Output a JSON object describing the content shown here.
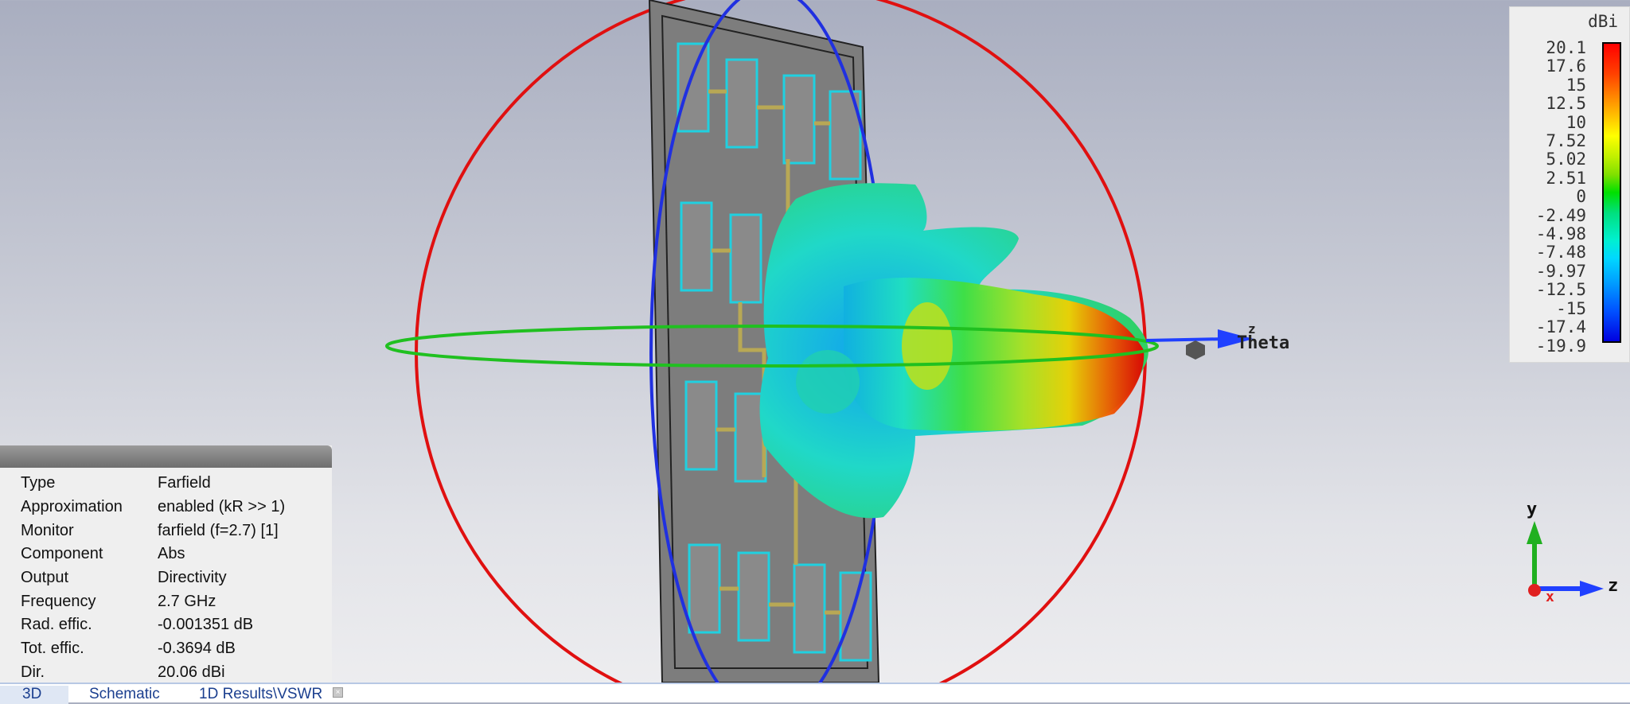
{
  "legend": {
    "unit": "dBi",
    "ticks": [
      "20.1",
      "17.6",
      "15",
      "12.5",
      "10",
      "7.52",
      "5.02",
      "2.51",
      "0",
      "-2.49",
      "-4.98",
      "-7.48",
      "-9.97",
      "-12.5",
      "-15",
      "-17.4",
      "-19.9"
    ]
  },
  "info": {
    "rows": [
      {
        "key": "Type",
        "value": "Farfield"
      },
      {
        "key": "Approximation",
        "value": "enabled (kR >> 1)"
      },
      {
        "key": "Monitor",
        "value": "farfield (f=2.7) [1]"
      },
      {
        "key": "Component",
        "value": "Abs"
      },
      {
        "key": "Output",
        "value": "Directivity"
      },
      {
        "key": "Frequency",
        "value": "2.7 GHz"
      },
      {
        "key": "Rad. effic.",
        "value": "-0.001351 dB"
      },
      {
        "key": "Tot. effic.",
        "value": "-0.3694 dB"
      },
      {
        "key": "Dir.",
        "value": "20.06 dBi"
      }
    ]
  },
  "scene_labels": {
    "theta": "Theta",
    "z_small": "z",
    "axis_y": "y",
    "axis_z": "z",
    "axis_x": "x"
  },
  "tabs": [
    {
      "label": "3D"
    },
    {
      "label": "Schematic"
    },
    {
      "label": "1D Results\\VSWR"
    }
  ],
  "close_glyph": "×"
}
